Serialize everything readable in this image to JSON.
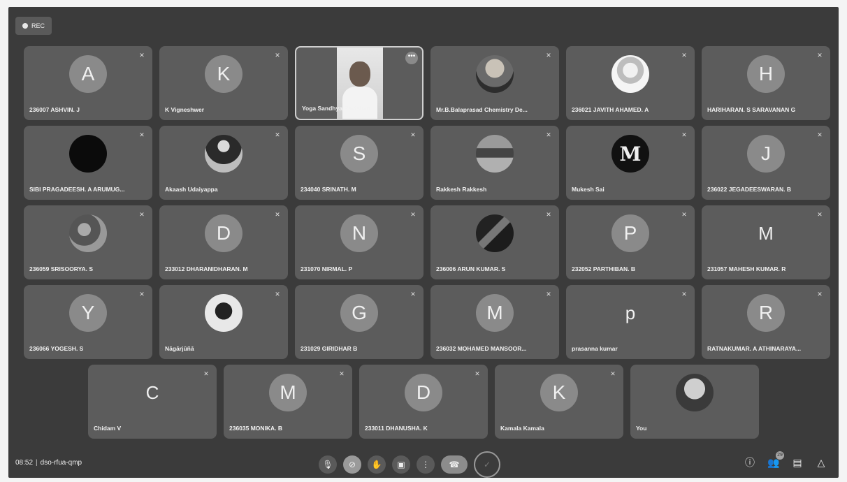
{
  "recording": {
    "label": "REC"
  },
  "tiles": [
    {
      "name": "236007 ASHVIN. J",
      "initial": "A"
    },
    {
      "name": "K Vigneshwer",
      "initial": "K"
    },
    {
      "name": "Yoga Sandhya Ravishan"
    },
    {
      "name": "Mr.B.Balaprasad Chemistry De..."
    },
    {
      "name": "236021 JAVITH AHAMED. A"
    },
    {
      "name": "HARIHARAN. S SARAVANAN G",
      "initial": "H"
    },
    {
      "name": "SIBI PRAGADEESH. A ARUMUG..."
    },
    {
      "name": "Akaash Udaiyappa"
    },
    {
      "name": "234040 SRINATH. M",
      "initial": "S"
    },
    {
      "name": "Rakkesh Rakkesh"
    },
    {
      "name": "Mukesh Sai",
      "initial": "M"
    },
    {
      "name": "236022 JEGADEESWARAN. B",
      "initial": "J"
    },
    {
      "name": "236059 SRISOORYA. S"
    },
    {
      "name": "233012 DHARANIDHARAN. M",
      "initial": "D"
    },
    {
      "name": "231070 NIRMAL. P",
      "initial": "N"
    },
    {
      "name": "236006 ARUN KUMAR. S"
    },
    {
      "name": "232052 PARTHIBAN. B",
      "initial": "P"
    },
    {
      "name": "231057 MAHESH KUMAR. R",
      "initial": "M"
    },
    {
      "name": "236066 YOGESH. S",
      "initial": "Y"
    },
    {
      "name": "Nāgārjūñā"
    },
    {
      "name": "231029 GIRIDHAR B",
      "initial": "G"
    },
    {
      "name": "236032 MOHAMED MANSOOR...",
      "initial": "M"
    },
    {
      "name": "prasanna kumar",
      "initial": "p"
    },
    {
      "name": "RATNAKUMAR. A ATHINARAYA...",
      "initial": "R"
    },
    {
      "name": "Chidam V",
      "initial": "C"
    },
    {
      "name": "236035 MONIKA. B",
      "initial": "M"
    },
    {
      "name": "233011 DHANUSHA. K",
      "initial": "D"
    },
    {
      "name": "Kamala Kamala",
      "initial": "K"
    },
    {
      "name": "You"
    }
  ],
  "bottom": {
    "time": "08:52",
    "separator": "|",
    "meeting_code": "dso-rfua-qmp",
    "participants_badge": "29"
  },
  "colors": {
    "background": "#3b3b3b",
    "tile": "#5c5c5c",
    "avatar": "#8a8a8a"
  }
}
